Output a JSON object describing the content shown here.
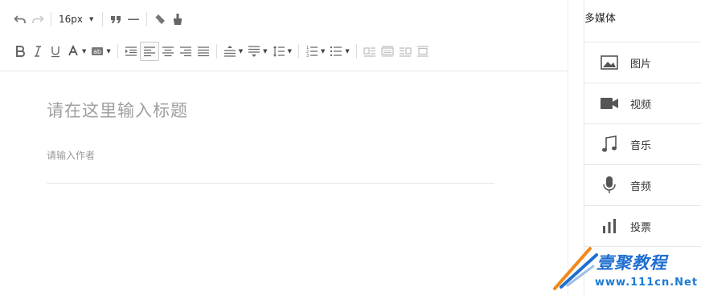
{
  "toolbar": {
    "font_size": "16px"
  },
  "editor": {
    "title_placeholder": "请在这里输入标题",
    "author_placeholder": "请输入作者"
  },
  "sidebar": {
    "title": "多媒体",
    "items": [
      {
        "label": "图片",
        "icon": "image-icon"
      },
      {
        "label": "视频",
        "icon": "video-icon"
      },
      {
        "label": "音乐",
        "icon": "music-note-icon"
      },
      {
        "label": "音频",
        "icon": "microphone-icon"
      },
      {
        "label": "投票",
        "icon": "poll-icon"
      }
    ]
  },
  "watermark": {
    "brand": "壹聚教程",
    "url": "www.111cn.Net"
  },
  "colors": {
    "icon_gray": "#666666",
    "disabled_gray": "#c4c4c4",
    "border": "#e7e7eb",
    "watermark_blue": "#1f6fd1",
    "watermark_orange": "#f08a1c"
  }
}
